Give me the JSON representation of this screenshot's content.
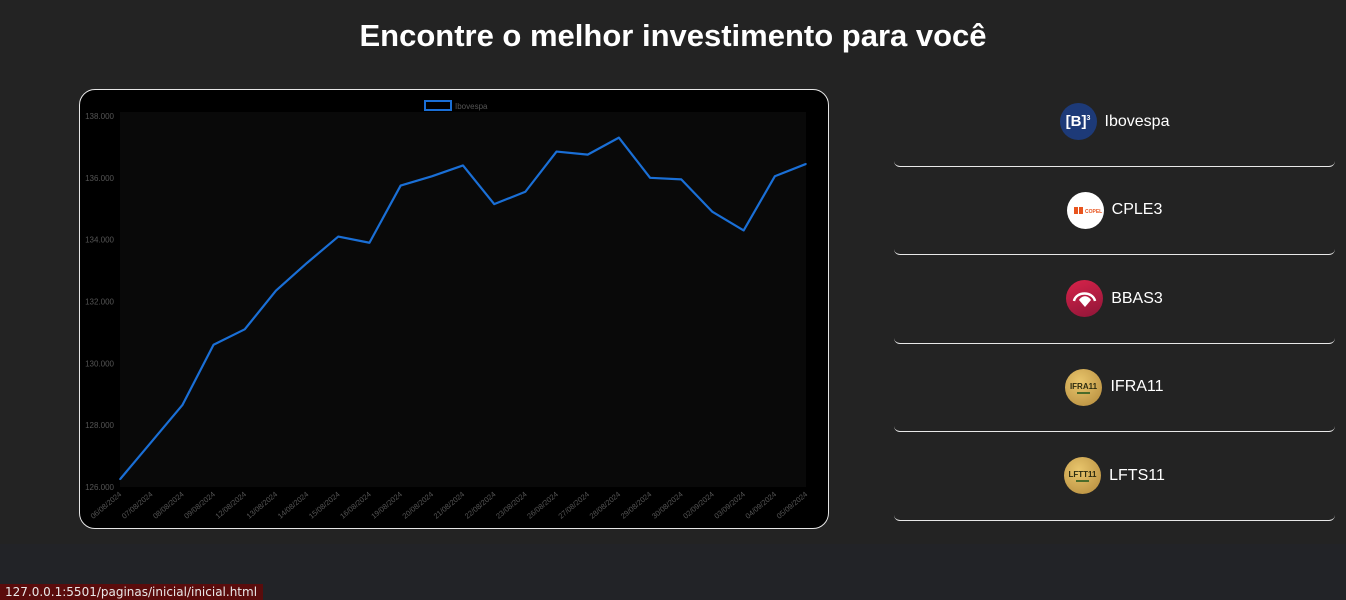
{
  "page": {
    "title": "Encontre o melhor investimento para você"
  },
  "status_url": "127.0.0.1:5501/paginas/inicial/inicial.html",
  "assets": [
    {
      "name": "Ibovespa",
      "icon": "b3-logo-icon",
      "logo_text": "[B]",
      "logo_sup": "3",
      "logo_bg": "#1d3a78"
    },
    {
      "name": "CPLE3",
      "icon": "copel-logo-icon",
      "logo_text": "COPEL",
      "logo_bg": "#ffffff"
    },
    {
      "name": "BBAS3",
      "icon": "bradesco-logo-icon",
      "logo_text": "",
      "logo_bg": "#c8102e"
    },
    {
      "name": "IFRA11",
      "icon": "ifra11-coin-icon",
      "logo_text": "IFRA11",
      "logo_bg": "#c9a24a"
    },
    {
      "name": "LFTS11",
      "icon": "lfts11-coin-icon",
      "logo_text": "LFTT11",
      "logo_bg": "#c9a24a"
    }
  ],
  "colors": {
    "line": "#1a6fd6",
    "grid_text": "#555555",
    "plot_bg": "#090909"
  },
  "chart_data": {
    "type": "line",
    "series": [
      {
        "name": "Ibovespa",
        "values": [
          126250,
          127450,
          128650,
          130600,
          131100,
          132350,
          133250,
          134100,
          133900,
          135750,
          136050,
          136400,
          135150,
          135550,
          136850,
          136750,
          137300,
          136000,
          135950,
          134900,
          134300,
          136050,
          136450
        ]
      }
    ],
    "categories": [
      "06/08/2024",
      "07/08/2024",
      "08/08/2024",
      "09/08/2024",
      "12/08/2024",
      "13/08/2024",
      "14/08/2024",
      "15/08/2024",
      "16/08/2024",
      "19/08/2024",
      "20/08/2024",
      "21/08/2024",
      "22/08/2024",
      "23/08/2024",
      "26/08/2024",
      "27/08/2024",
      "28/08/2024",
      "29/08/2024",
      "30/08/2024",
      "02/09/2024",
      "03/09/2024",
      "04/09/2024",
      "05/09/2024"
    ],
    "yticks": [
      "126.000",
      "128.000",
      "130.000",
      "132.000",
      "134.000",
      "136.000",
      "138.000"
    ],
    "ylim": [
      126000,
      138000
    ],
    "legend": "top-center",
    "grid": false
  }
}
